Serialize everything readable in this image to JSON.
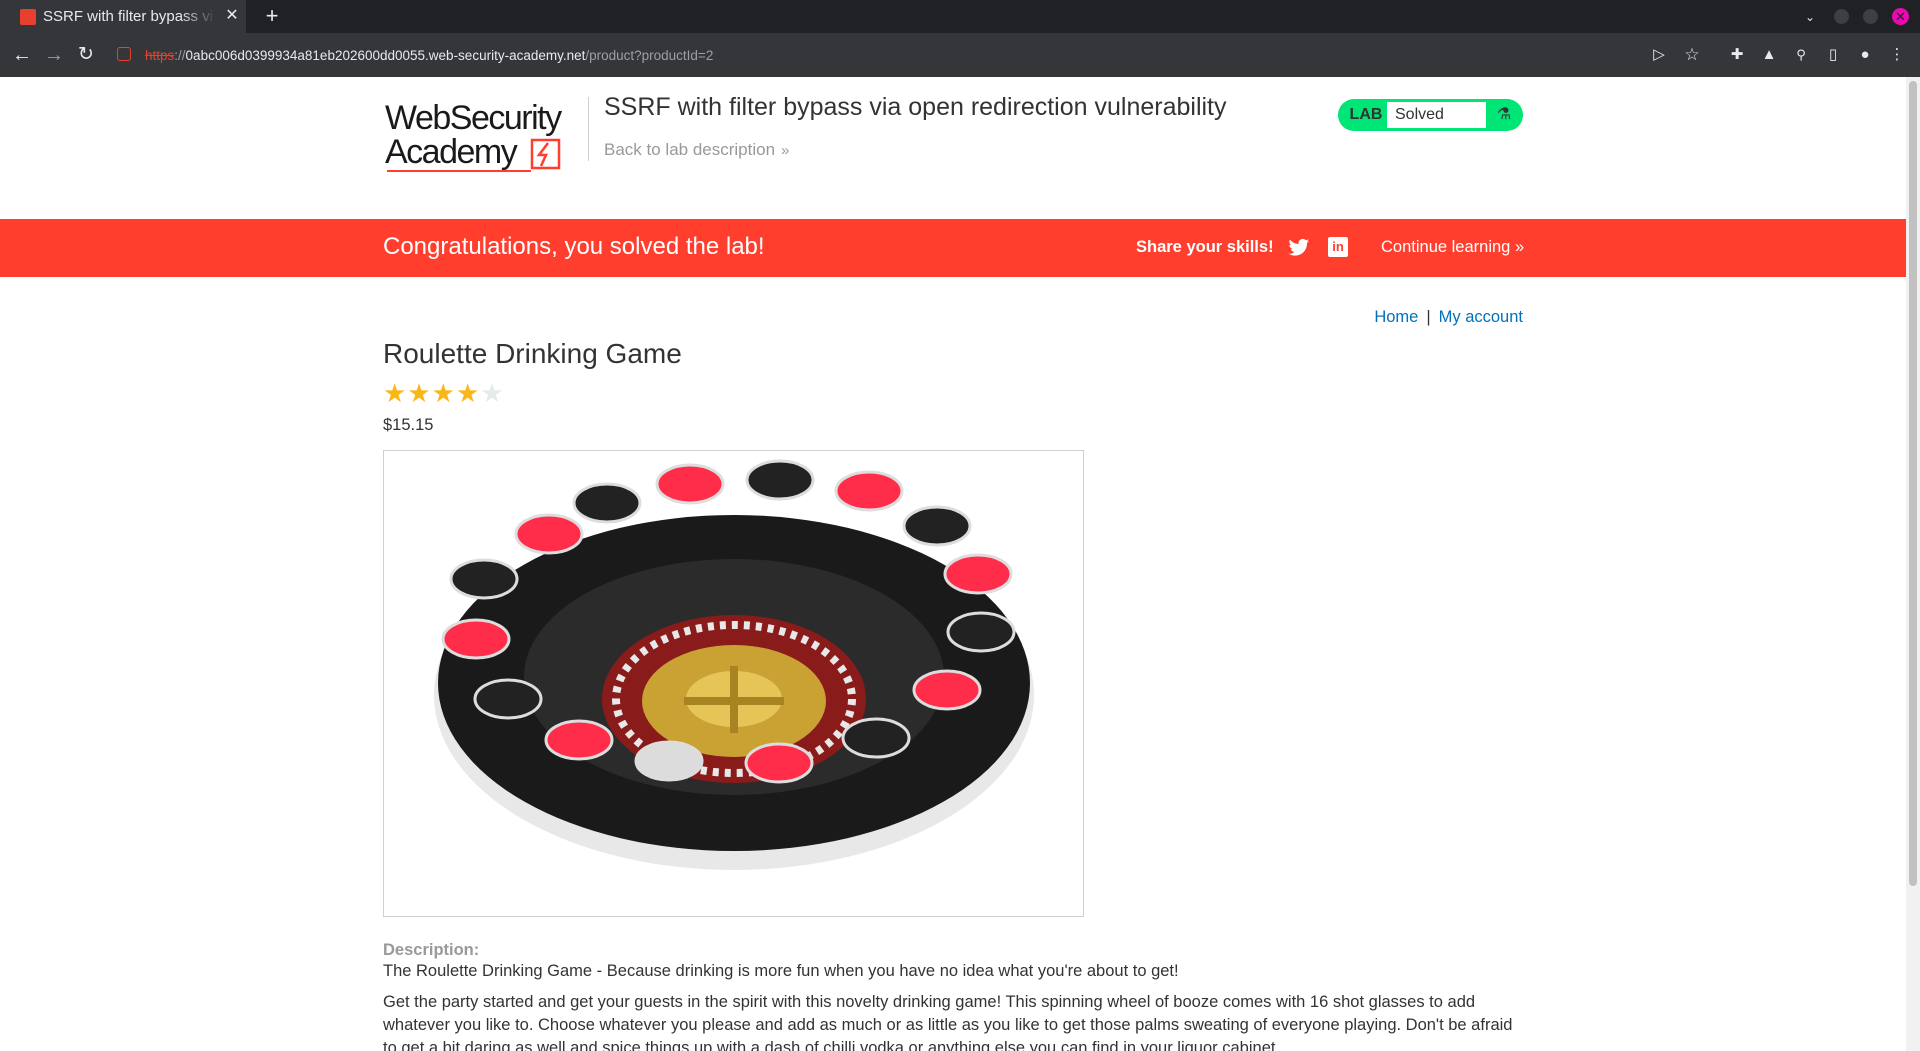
{
  "browser": {
    "tab_title": "SSRF with filter bypass via open redirection vulnerability",
    "url_scheme": "https",
    "url_sep": "://",
    "url_host": "0abc006d0399934a81eb202600dd0055.web-security-academy.net",
    "url_path": "/product?productId=2"
  },
  "header": {
    "logo_line1": "WebSecurity",
    "logo_line2": "Academy",
    "lab_title": "SSRF with filter bypass via open redirection vulnerability",
    "back_link": "Back to lab description",
    "status_lab": "LAB",
    "status_value": "Solved"
  },
  "banner": {
    "message": "Congratulations, you solved the lab!",
    "share_label": "Share your skills!",
    "continue_label": "Continue learning"
  },
  "nav": {
    "home": "Home",
    "separator": "|",
    "account": "My account"
  },
  "product": {
    "title": "Roulette Drinking Game",
    "rating": 4,
    "rating_max": 5,
    "price": "$15.15",
    "description_label": "Description:",
    "description_lead": "The Roulette Drinking Game - Because drinking is more fun when you have no idea what you're about to get!",
    "description_body": "Get the party started and get your guests in the spirit with this novelty drinking game! This spinning wheel of booze comes with 16 shot glasses to add whatever you like to. Choose whatever you please and add as much or as little as you like to get those palms sweating of everyone playing. Don't be afraid to get a bit daring as well and spice things up with a dash of chilli vodka or anything else you can find in your liquor cabinet."
  },
  "colors": {
    "banner": "#ff3e2e",
    "lab_solved": "#00e676",
    "link": "#0071bc",
    "star": "#f9b717"
  }
}
